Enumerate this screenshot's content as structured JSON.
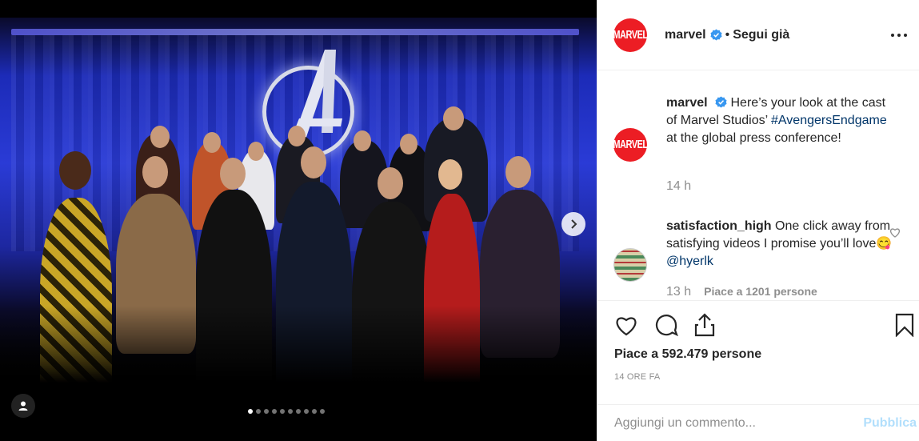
{
  "post": {
    "author": "marvel",
    "author_logo_text": "MARVEL",
    "follow_separator": "•",
    "follow_label": "Segui già",
    "carousel": {
      "slide_count": 10,
      "active_slide": 1
    }
  },
  "comments": [
    {
      "author": "marvel",
      "text_before": "Here’s your look at the cast of Marvel Studios’ ",
      "hashtag": "#AvengersEndgame",
      "text_after": " at the global press conference!",
      "time": "14 h"
    },
    {
      "author": "satisfaction_high",
      "text_before": "One click away from satisfying videos I promise you’ll love",
      "emoji": "😋",
      "mention": "@hyerlk",
      "time": "13 h",
      "likes": "Piace a 1201 persone"
    }
  ],
  "actions": {
    "likes": "Piace a 592.479 persone",
    "time_ago": "14 ORE FA",
    "comment_placeholder": "Aggiungi un commento...",
    "publish_label": "Pubblica"
  },
  "icons": {
    "verified": "verified-badge-icon",
    "more": "more-options-icon",
    "like": "heart-icon",
    "comment": "comment-icon",
    "share": "share-icon",
    "save": "bookmark-icon",
    "next": "chevron-right-icon",
    "tag": "user-tag-icon"
  },
  "colors": {
    "brand_red": "#ec1d24",
    "verified_blue": "#3897f0",
    "link": "#003569",
    "publish_disabled": "#b2dffc"
  }
}
